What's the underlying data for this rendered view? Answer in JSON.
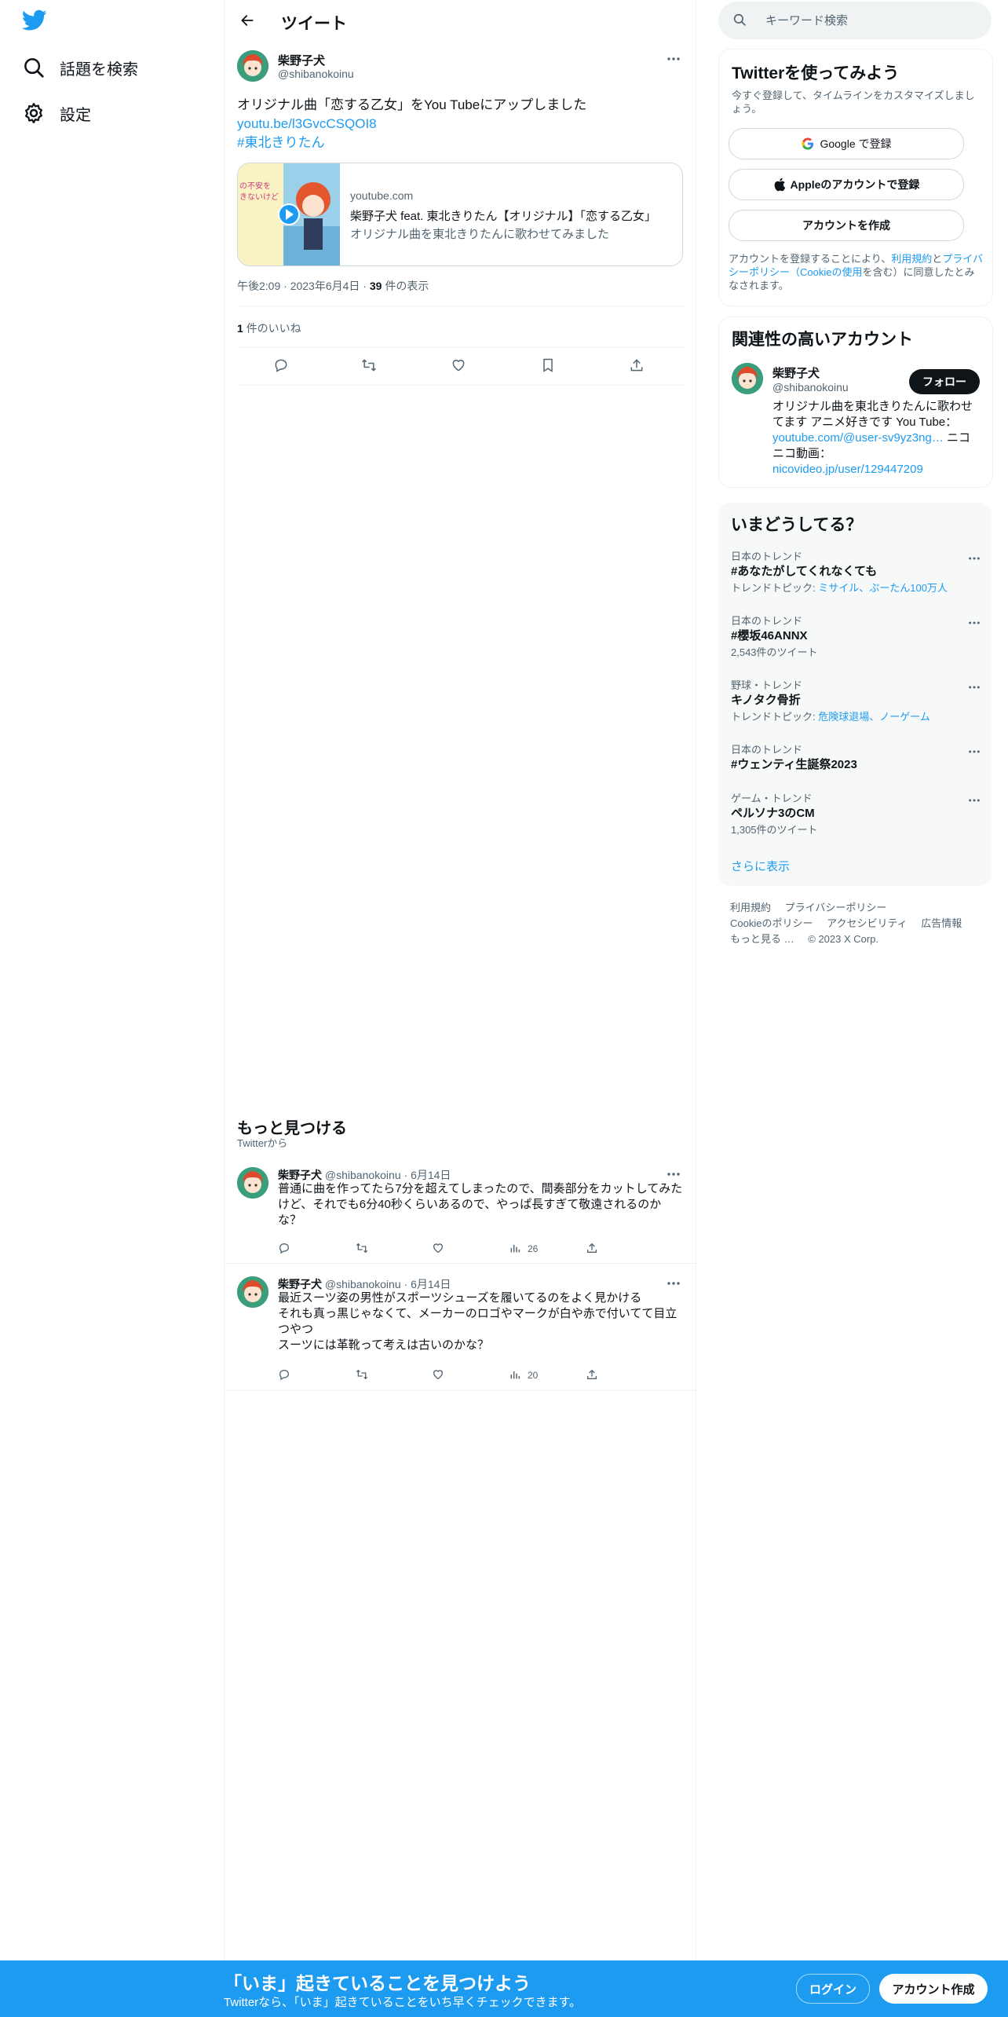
{
  "nav": {
    "logo_icon": "twitter-bird-icon",
    "explore_label": "話題を検索",
    "settings_label": "設定"
  },
  "header": {
    "title": "ツイート"
  },
  "tweet": {
    "author_name": "柴野子犬",
    "author_handle": "@shibanokoinu",
    "text_line1": "オリジナル曲「恋する乙女」をYou Tubeにアップしました",
    "link": "youtu.be/l3GvcCSQOI8",
    "hashtag": "#東北きりたん",
    "card": {
      "thumb_caption": "の不安を\nきないけど",
      "domain": "youtube.com",
      "title": "柴野子犬 feat. 東北きりたん【オリジナル】「恋する乙女」",
      "description": "オリジナル曲を東北きりたんに歌わせてみました"
    },
    "time": "午後2:09",
    "date": "2023年6月4日",
    "views_count": "39",
    "views_label": "件の表示",
    "likes_count": "1",
    "likes_label": "件のいいね"
  },
  "discover": {
    "title": "もっと見つける",
    "subtitle": "Twitterから",
    "tweets": [
      {
        "name": "柴野子犬",
        "handle": "@shibanokoinu",
        "date": "6月14日",
        "text": "普通に曲を作ってたら7分を超えてしまったので、間奏部分をカットしてみたけど、それでも6分40秒くらいあるので、やっぱ長すぎて敬遠されるのかな？",
        "views": "26"
      },
      {
        "name": "柴野子犬",
        "handle": "@shibanokoinu",
        "date": "6月14日",
        "text_lines": [
          "最近スーツ姿の男性がスポーツシューズを履いてるのをよく見かける",
          "それも真っ黒じゃなくて、メーカーのロゴやマークが白や赤で付いてて目立つやつ",
          "スーツには革靴って考えは古いのかな？"
        ],
        "views": "20"
      }
    ]
  },
  "search": {
    "placeholder": "キーワード検索"
  },
  "signup_panel": {
    "title": "Twitterを使ってみよう",
    "description": "今すぐ登録して、タイムラインをカスタマイズしましょう。",
    "google_label": "Google で登録",
    "apple_label": "Appleのアカウントで登録",
    "create_label": "アカウントを作成",
    "terms_prefix": "アカウントを登録することにより、",
    "terms_link": "利用規約",
    "terms_and": "と",
    "privacy_link": "プライバシーポリシー",
    "cookie_link": "（Cookieの使用",
    "terms_suffix": "を含む）に同意したとみなされます。"
  },
  "related": {
    "title": "関連性の高いアカウント",
    "name": "柴野子犬",
    "handle": "@shibanokoinu",
    "follow_label": "フォロー",
    "bio_text": "オリジナル曲を東北きりたんに歌わせてます アニメ好きです You Tube：",
    "bio_link1": "youtube.com/@user-sv9yz3ng…",
    "bio_mid": " ニコニコ動画：",
    "bio_link2": "nicovideo.jp/user/129447209"
  },
  "trends": {
    "title": "いまどうしてる？",
    "items": [
      {
        "context": "日本のトレンド",
        "name": "#あなたがしてくれなくても",
        "sub_prefix": "トレンドトピック: ",
        "sub_links": "ミサイル、ぷーたん100万人"
      },
      {
        "context": "日本のトレンド",
        "name": "#櫻坂46ANNX",
        "sub": "2,543件のツイート"
      },
      {
        "context": "野球・トレンド",
        "name": "キノタク骨折",
        "sub_prefix": "トレンドトピック: ",
        "sub_links": "危険球退場、ノーゲーム"
      },
      {
        "context": "日本のトレンド",
        "name": "#ウェンティ生誕祭2023"
      },
      {
        "context": "ゲーム・トレンド",
        "name": "ペルソナ3のCM",
        "sub": "1,305件のツイート"
      }
    ],
    "show_more": "さらに表示"
  },
  "footer": {
    "terms": "利用規約",
    "privacy": "プライバシーポリシー",
    "cookie": "Cookieのポリシー",
    "accessibility": "アクセシビリティ",
    "ads": "広告情報",
    "more": "もっと見る …",
    "copyright": "© 2023 X Corp."
  },
  "bottom_bar": {
    "title": "「いま」起きていることを見つけよう",
    "subtitle": "Twitterなら、「いま」起きていることをいち早くチェックできます。",
    "login_label": "ログイン",
    "signup_label": "アカウント作成"
  },
  "colors": {
    "accent": "#1d9bf0",
    "text": "#0f1419",
    "muted": "#536471",
    "border": "#eff3f4"
  }
}
